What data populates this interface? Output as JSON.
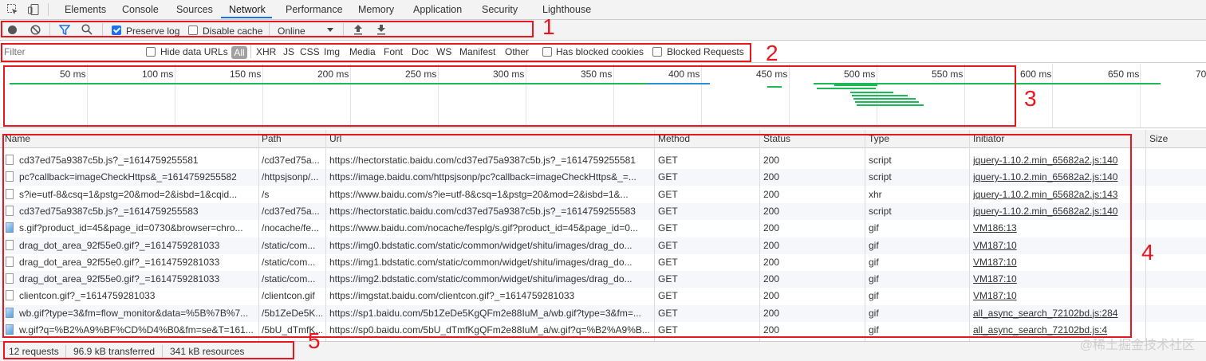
{
  "tabs": [
    "Elements",
    "Console",
    "Sources",
    "Network",
    "Performance",
    "Memory",
    "Application",
    "Security",
    "Lighthouse"
  ],
  "active_tab": "Network",
  "toolbar": {
    "preserve_log": "Preserve log",
    "disable_cache": "Disable cache",
    "throttle": "Online"
  },
  "filter": {
    "placeholder": "Filter",
    "hide_data_urls": "Hide data URLs",
    "types": [
      "All",
      "XHR",
      "JS",
      "CSS",
      "Img",
      "Media",
      "Font",
      "Doc",
      "WS",
      "Manifest",
      "Other"
    ],
    "has_blocked_cookies": "Has blocked cookies",
    "blocked_requests": "Blocked Requests"
  },
  "overview": {
    "ticks": [
      "50 ms",
      "100 ms",
      "150 ms",
      "200 ms",
      "250 ms",
      "300 ms",
      "350 ms",
      "400 ms",
      "450 ms",
      "500 ms",
      "550 ms",
      "600 ms",
      "650 ms",
      "70"
    ]
  },
  "annotations": [
    "1",
    "2",
    "3",
    "4",
    "5"
  ],
  "table": {
    "headers": [
      "Name",
      "Path",
      "Url",
      "Method",
      "Status",
      "Type",
      "Initiator",
      "Size"
    ],
    "rows": [
      {
        "name": "cd37ed75a9387c5b.js?_=1614759255581",
        "path": "/cd37ed75a...",
        "url": "https://hectorstatic.baidu.com/cd37ed75a9387c5b.js?_=1614759255581",
        "method": "GET",
        "status": "200",
        "type": "script",
        "initiator": "jquery-1.10.2.min_65682a2.js:140",
        "icon": "doc"
      },
      {
        "name": "pc?callback=imageCheckHttps&_=1614759255582",
        "path": "/httpsjsonp/...",
        "url": "https://image.baidu.com/httpsjsonp/pc?callback=imageCheckHttps&_=...",
        "method": "GET",
        "status": "200",
        "type": "script",
        "initiator": "jquery-1.10.2.min_65682a2.js:140",
        "icon": "doc"
      },
      {
        "name": "s?ie=utf-8&csq=1&pstg=20&mod=2&isbd=1&cqid...",
        "path": "/s",
        "url": "https://www.baidu.com/s?ie=utf-8&csq=1&pstg=20&mod=2&isbd=1&...",
        "method": "GET",
        "status": "200",
        "type": "xhr",
        "initiator": "jquery-1.10.2.min_65682a2.js:143",
        "icon": "doc"
      },
      {
        "name": "cd37ed75a9387c5b.js?_=1614759255583",
        "path": "/cd37ed75a...",
        "url": "https://hectorstatic.baidu.com/cd37ed75a9387c5b.js?_=1614759255583",
        "method": "GET",
        "status": "200",
        "type": "script",
        "initiator": "jquery-1.10.2.min_65682a2.js:140",
        "icon": "doc"
      },
      {
        "name": "s.gif?product_id=45&page_id=0730&browser=chro...",
        "path": "/nocache/fe...",
        "url": "https://www.baidu.com/nocache/fesplg/s.gif?product_id=45&page_id=0...",
        "method": "GET",
        "status": "200",
        "type": "gif",
        "initiator": "VM186:13",
        "icon": "img"
      },
      {
        "name": "drag_dot_area_92f55e0.gif?_=1614759281033",
        "path": "/static/com...",
        "url": "https://img0.bdstatic.com/static/common/widget/shitu/images/drag_do...",
        "method": "GET",
        "status": "200",
        "type": "gif",
        "initiator": "VM187:10",
        "icon": "doc"
      },
      {
        "name": "drag_dot_area_92f55e0.gif?_=1614759281033",
        "path": "/static/com...",
        "url": "https://img1.bdstatic.com/static/common/widget/shitu/images/drag_do...",
        "method": "GET",
        "status": "200",
        "type": "gif",
        "initiator": "VM187:10",
        "icon": "doc"
      },
      {
        "name": "drag_dot_area_92f55e0.gif?_=1614759281033",
        "path": "/static/com...",
        "url": "https://img2.bdstatic.com/static/common/widget/shitu/images/drag_do...",
        "method": "GET",
        "status": "200",
        "type": "gif",
        "initiator": "VM187:10",
        "icon": "doc"
      },
      {
        "name": "clientcon.gif?_=1614759281033",
        "path": "/clientcon.gif",
        "url": "https://imgstat.baidu.com/clientcon.gif?_=1614759281033",
        "method": "GET",
        "status": "200",
        "type": "gif",
        "initiator": "VM187:10",
        "icon": "doc"
      },
      {
        "name": "wb.gif?type=3&fm=flow_monitor&data=%5B%7B%7...",
        "path": "/5b1ZeDe5K...",
        "url": "https://sp1.baidu.com/5b1ZeDe5KgQFm2e88IuM_a/wb.gif?type=3&fm=...",
        "method": "GET",
        "status": "200",
        "type": "gif",
        "initiator": "all_async_search_72102bd.js:284",
        "icon": "img"
      },
      {
        "name": "w.gif?q=%B2%A9%BF%CD%D4%B0&fm=se&T=161...",
        "path": "/5bU_dTmfK...",
        "url": "https://sp0.baidu.com/5bU_dTmfKgQFm2e88IuM_a/w.gif?q=%B2%A9%B...",
        "method": "GET",
        "status": "200",
        "type": "gif",
        "initiator": "all_async_search_72102bd.js:4",
        "icon": "img"
      }
    ]
  },
  "status_bar": {
    "requests": "12 requests",
    "transferred": "96.9 kB transferred",
    "resources": "341 kB resources"
  },
  "watermark": "@稀土掘金技术社区",
  "colors": {
    "accent": "#1a73e8",
    "annotation_red": "#e8161e",
    "waterfall_green": "#1db954",
    "waterfall_blue": "#2a8fd6"
  }
}
